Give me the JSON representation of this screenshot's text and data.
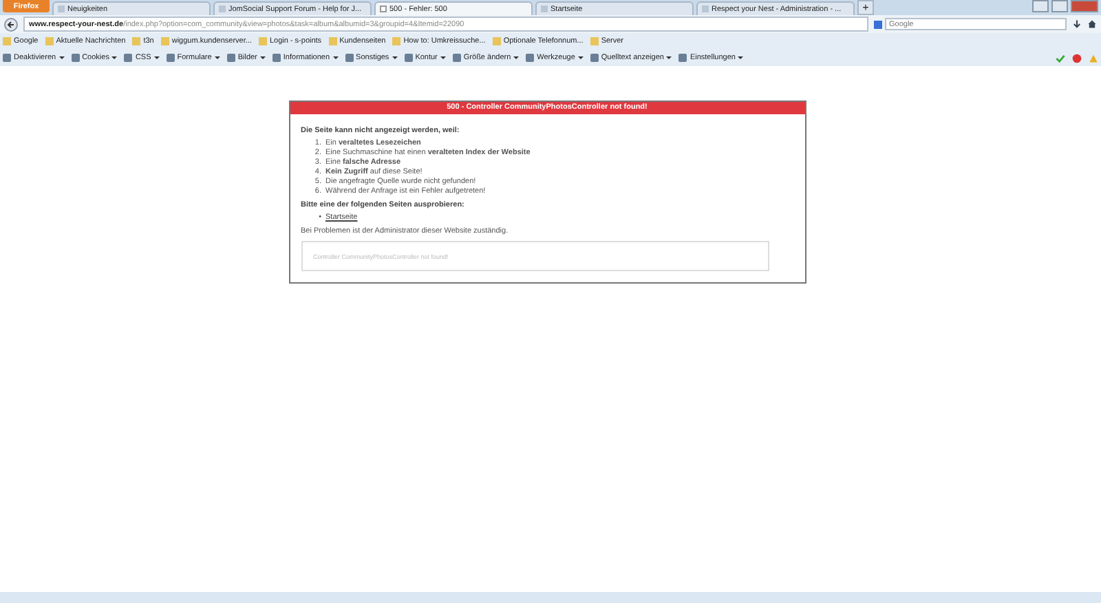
{
  "browser": {
    "menu_button": "Firefox",
    "tabs": [
      {
        "label": "Neuigkeiten",
        "selected": false
      },
      {
        "label": "JomSocial Support Forum - Help for J...",
        "selected": false
      },
      {
        "label": "500 - Fehler: 500",
        "selected": true
      },
      {
        "label": "Startseite",
        "selected": false
      },
      {
        "label": "Respect your Nest - Administration - ...",
        "selected": false
      }
    ],
    "new_tab": "+",
    "url_domain": "www.respect-your-nest.de",
    "url_path": "/index.php?option=com_community&view=photos&task=album&albumid=3&groupid=4&Itemid=22090",
    "search": {
      "placeholder": "Google"
    },
    "bookmarks": [
      "Google",
      "Aktuelle Nachrichten",
      "t3n",
      "wiggum.kundenserver...",
      "Login - s-points",
      "Kundenseiten",
      "How to: Umkreissuche...",
      "Optionale Telefonnum...",
      "Server"
    ],
    "developer_toolbar": [
      "Deaktivieren",
      "Cookies",
      "CSS",
      "Formulare",
      "Bilder",
      "Informationen",
      "Sonstiges",
      "Kontur",
      "Größe ändern",
      "Werkzeuge",
      "Quelltext anzeigen",
      "Einstellungen"
    ]
  },
  "error_page": {
    "title": "500 - Controller CommunityPhotosController not found!",
    "intro": "Die Seite kann nicht angezeigt werden, weil:",
    "reasons": [
      {
        "marker": "1.",
        "text": "Ein **veraltetes Lesezeichen**"
      },
      {
        "marker": "2.",
        "text": "Eine Suchmaschine hat einen **veralteten Index der Website**"
      },
      {
        "marker": "3.",
        "text": "Eine **falsche Adresse**"
      },
      {
        "marker": "4.",
        "text": "**Kein Zugriff** auf diese Seite!"
      },
      {
        "marker": "5.",
        "text": "Die angefragte Quelle wurde nicht gefunden!"
      },
      {
        "marker": "6.",
        "text": "Während der Anfrage ist ein Fehler aufgetreten!"
      }
    ],
    "try_heading": "Bitte eine der folgenden Seiten ausprobieren:",
    "links": [
      {
        "bullet": "•",
        "label": "Startseite"
      }
    ],
    "contact": "Bei Problemen ist der Administrator dieser Website zuständig.",
    "message": "Controller CommunityPhotosController not found!"
  }
}
